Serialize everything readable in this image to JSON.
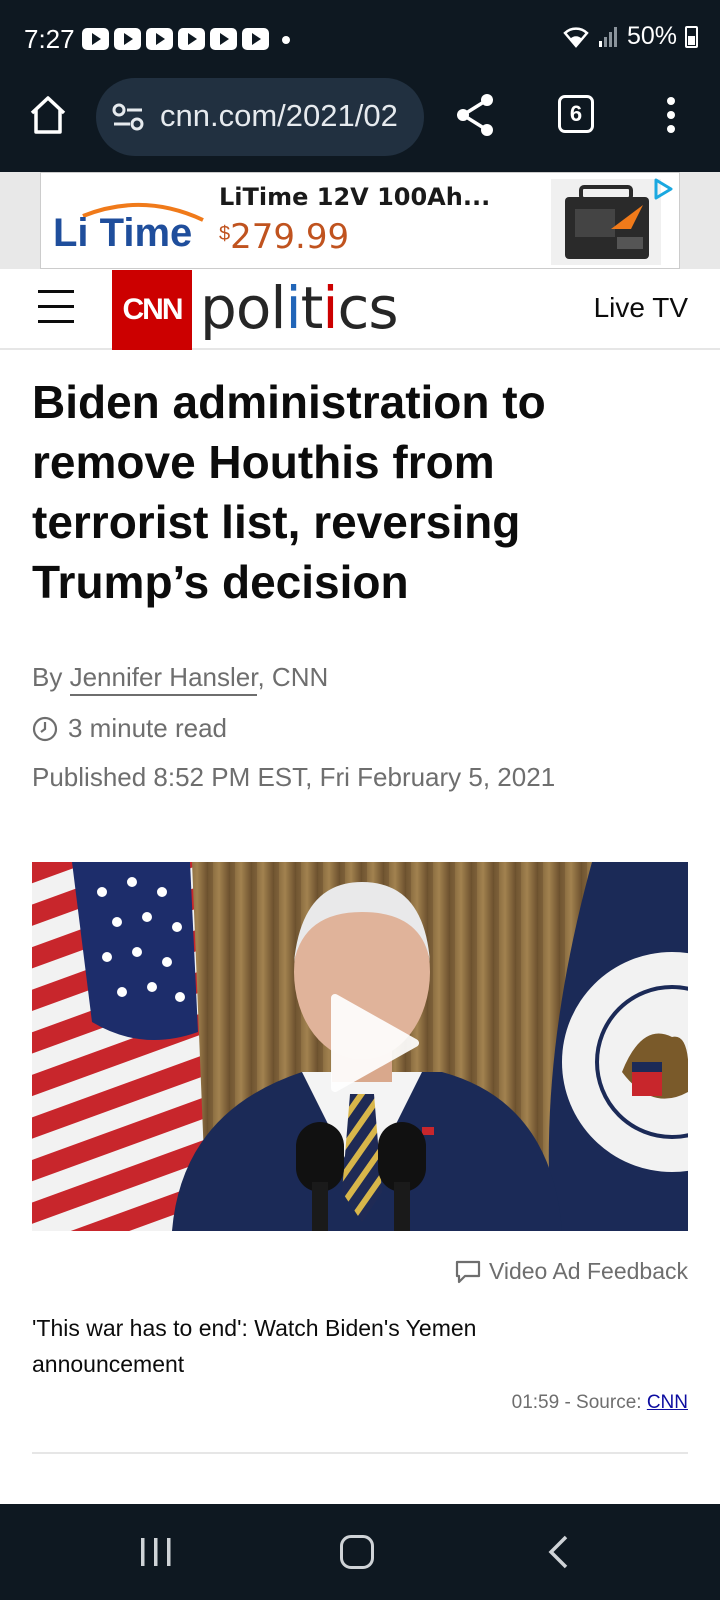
{
  "status_bar": {
    "time": "7:27",
    "battery": "50%"
  },
  "browser": {
    "url": "cnn.com/2021/02",
    "tab_count": "6"
  },
  "ad": {
    "brand": "Li Time",
    "title": "LiTime 12V 100Ah...",
    "currency": "$",
    "price": "279.99"
  },
  "site": {
    "logo": "CNN",
    "section": "politics",
    "live_tv": "Live TV"
  },
  "article": {
    "headline": "Biden administration to remove Houthis from terrorist list, reversing Trump’s decision",
    "by_prefix": "By ",
    "author": "Jennifer Hansler",
    "outlet_suffix": ", CNN",
    "read_time": "3 minute read",
    "published": "Published 8:52 PM EST, Fri February 5, 2021"
  },
  "video": {
    "feedback_label": "Video Ad Feedback",
    "caption": "'This war has to end': Watch Biden's Yemen announcement",
    "duration_source": "01:59 - Source: ",
    "source_link": "CNN"
  },
  "colors": {
    "cnn_red": "#cc0000",
    "chrome_dark": "#0e1821"
  }
}
